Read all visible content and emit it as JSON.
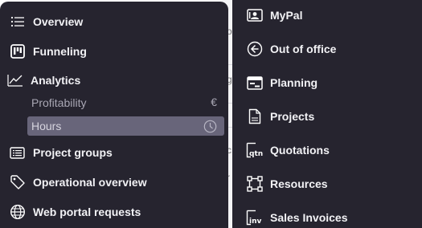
{
  "left_menu": {
    "items": [
      {
        "label": "Overview",
        "icon": "list-icon"
      },
      {
        "label": "Funneling",
        "icon": "kanban-icon"
      },
      {
        "label": "Analytics",
        "icon": "trend-line-icon"
      },
      {
        "label": "Project groups",
        "icon": "folder-list-icon"
      },
      {
        "label": "Operational overview",
        "icon": "tag-icon"
      },
      {
        "label": "Web portal requests",
        "icon": "globe-icon"
      }
    ],
    "analytics_sub": [
      {
        "label": "Profitability",
        "trail": "€",
        "icon": "euro-icon",
        "active": false
      },
      {
        "label": "Hours",
        "trail": "",
        "icon": "clock-icon",
        "active": true
      }
    ]
  },
  "right_menu": {
    "items": [
      {
        "label": "MyPal",
        "icon": "contact-card-icon"
      },
      {
        "label": "Out of office",
        "icon": "arrow-left-circle-icon"
      },
      {
        "label": "Planning",
        "icon": "calendar-icon"
      },
      {
        "label": "Projects",
        "icon": "document-icon"
      },
      {
        "label": "Quotations",
        "icon": "quotation-icon",
        "icon_text": "qtn"
      },
      {
        "label": "Resources",
        "icon": "resources-icon"
      },
      {
        "label": "Sales Invoices",
        "icon": "invoice-icon",
        "icon_text": "inv"
      }
    ]
  },
  "colors": {
    "panel_bg": "#26242f",
    "active_bg": "#68657a",
    "text": "#f2f2f5",
    "muted_text": "#a9a7b4"
  }
}
